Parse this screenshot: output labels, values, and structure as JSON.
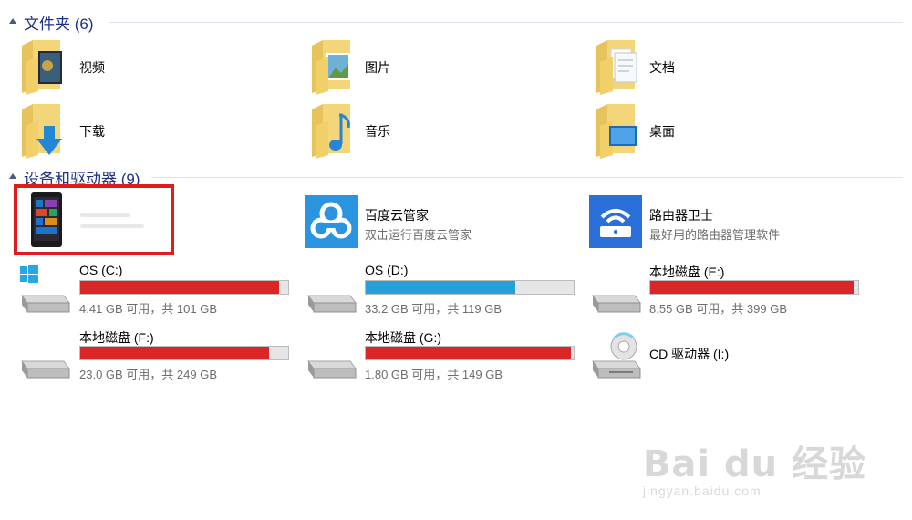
{
  "sections": {
    "folders": {
      "title": "文件夹 (6)"
    },
    "devices": {
      "title": "设备和驱动器 (9)"
    }
  },
  "folders": [
    {
      "label": "视频",
      "icon": "video-folder-icon"
    },
    {
      "label": "图片",
      "icon": "pictures-folder-icon"
    },
    {
      "label": "文档",
      "icon": "documents-folder-icon"
    },
    {
      "label": "下载",
      "icon": "downloads-folder-icon"
    },
    {
      "label": "音乐",
      "icon": "music-folder-icon"
    },
    {
      "label": "桌面",
      "icon": "desktop-folder-icon"
    }
  ],
  "apps": [
    {
      "name": "百度云管家",
      "desc": "双击运行百度云管家",
      "color": "#2b94e0",
      "icon": "baidu-cloud-icon"
    },
    {
      "name": "路由器卫士",
      "desc": "最好用的路由器管理软件",
      "color": "#2b6fd8",
      "icon": "router-guard-icon"
    }
  ],
  "phone": {
    "icon": "windows-phone-icon"
  },
  "drives": [
    {
      "name": "OS (C:)",
      "free": "4.41 GB 可用，共 101 GB",
      "used_fraction": 0.956,
      "bar_color": "#da2626",
      "icon": "windows-drive-icon"
    },
    {
      "name": "OS (D:)",
      "free": "33.2 GB 可用，共 119 GB",
      "used_fraction": 0.721,
      "bar_color": "#26a0da",
      "icon": "hard-drive-icon"
    },
    {
      "name": "本地磁盘 (E:)",
      "free": "8.55 GB 可用，共 399 GB",
      "used_fraction": 0.979,
      "bar_color": "#da2626",
      "icon": "hard-drive-icon"
    },
    {
      "name": "本地磁盘 (F:)",
      "free": "23.0 GB 可用，共 249 GB",
      "used_fraction": 0.908,
      "bar_color": "#da2626",
      "icon": "hard-drive-icon"
    },
    {
      "name": "本地磁盘 (G:)",
      "free": "1.80 GB 可用，共 149 GB",
      "used_fraction": 0.988,
      "bar_color": "#da2626",
      "icon": "hard-drive-icon"
    }
  ],
  "cd": {
    "name": "CD 驱动器 (I:)",
    "icon": "cd-drive-icon"
  },
  "watermark": {
    "logo": "Bai du 经验",
    "site": "jingyan.baidu.com"
  }
}
